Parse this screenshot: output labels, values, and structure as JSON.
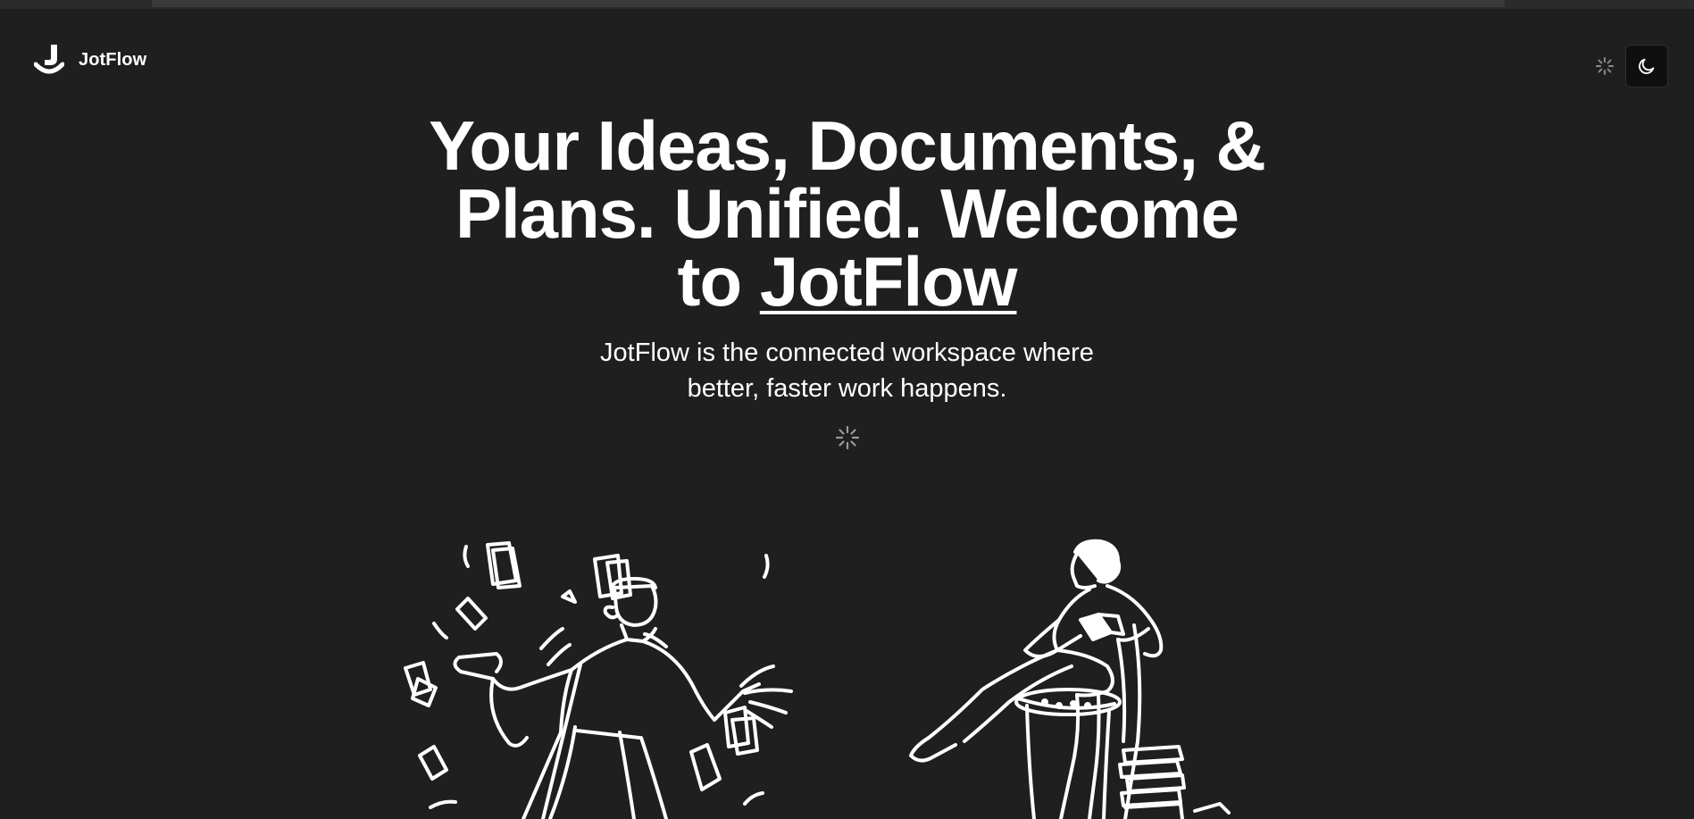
{
  "navbar": {
    "brand_name": "JotFlow",
    "logo_icon": "jotflow-logo-icon",
    "loading_icon": "loading-spinner-icon",
    "theme_toggle_icon": "moon-icon"
  },
  "hero": {
    "title_lines": [
      "Your Ideas, Documents, &",
      "Plans. Unified. Welcome",
      "to"
    ],
    "title_brand": "JotFlow",
    "subtitle_line1": "JotFlow is the connected workspace where",
    "subtitle_line2": "better, faster work happens.",
    "loading_icon": "loading-spinner-icon"
  },
  "illustrations": {
    "left": "person-throwing-papers-illustration",
    "right": "person-reading-chair-illustration"
  },
  "colors": {
    "background": "#1f1f1f",
    "text": "#ffffff",
    "toggle_bg": "#0f0f0f"
  }
}
